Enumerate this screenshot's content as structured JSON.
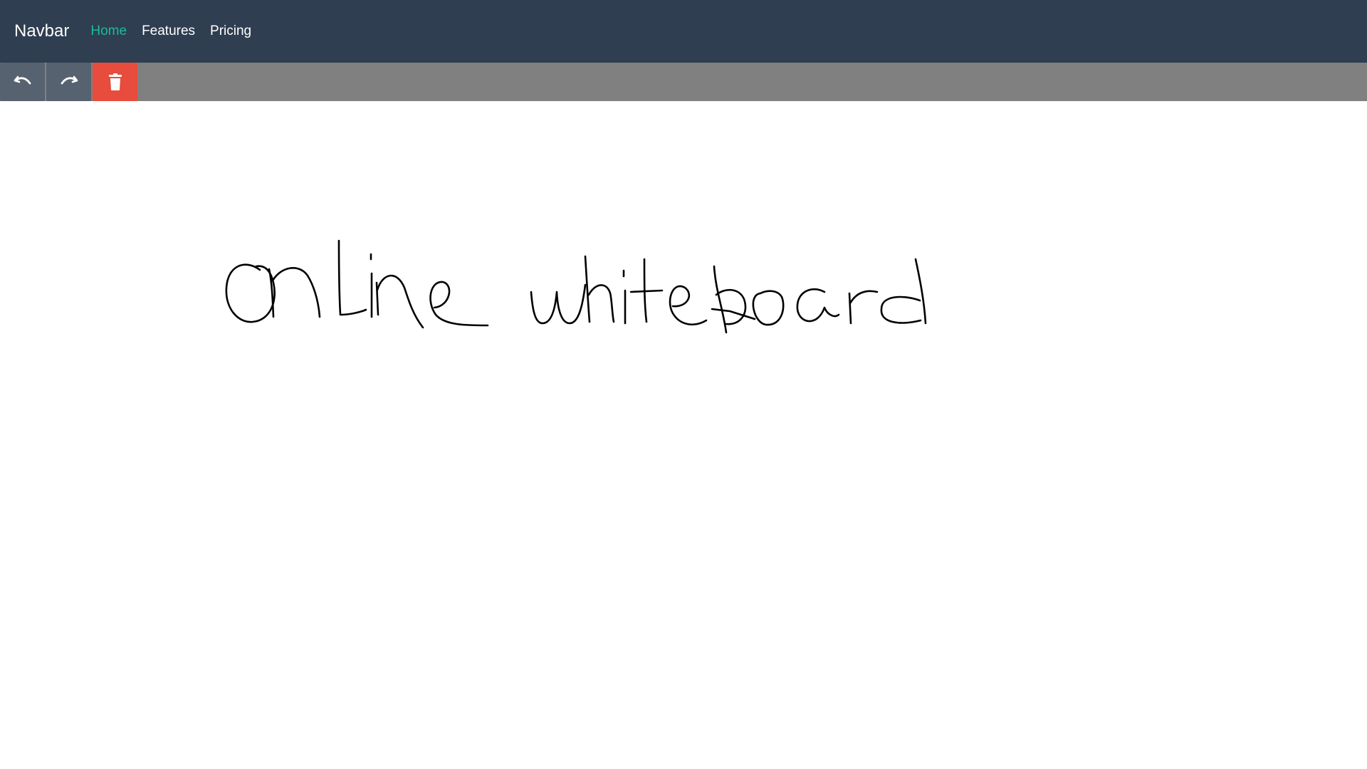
{
  "navbar": {
    "brand": "Navbar",
    "links": [
      {
        "label": "Home",
        "active": true
      },
      {
        "label": "Features",
        "active": false
      },
      {
        "label": "Pricing",
        "active": false
      }
    ]
  },
  "toolbar": {
    "buttons": [
      {
        "name": "undo",
        "icon": "undo-icon"
      },
      {
        "name": "redo",
        "icon": "redo-icon"
      },
      {
        "name": "clear",
        "icon": "trash-icon"
      }
    ]
  },
  "canvas": {
    "handwritten_text": "online whiteboard"
  },
  "colors": {
    "navbar_bg": "#2f3e50",
    "active_link": "#1abc9c",
    "toolbar_bg": "#808080",
    "button_bg": "#566270",
    "danger": "#e74c3c",
    "ink": "#000000"
  }
}
